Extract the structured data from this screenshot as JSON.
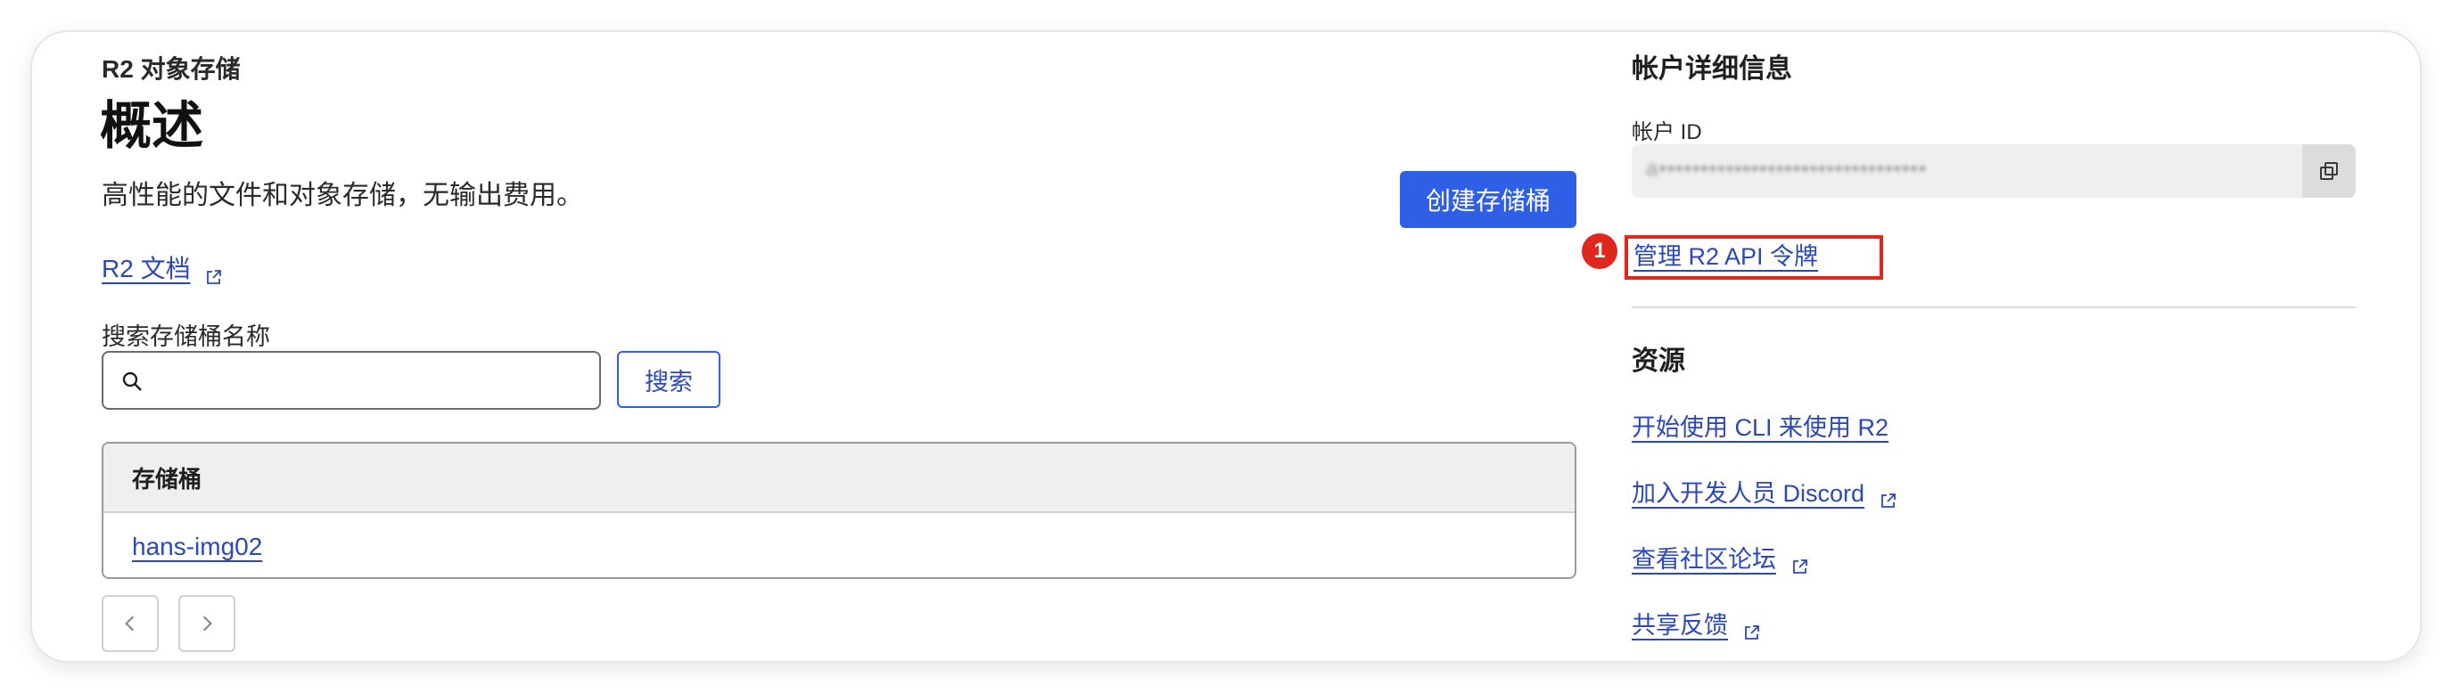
{
  "left": {
    "breadcrumb": "R2 对象存储",
    "title": "概述",
    "description": "高性能的文件和对象存储，无输出费用。",
    "create_button": "创建存储桶",
    "docs_link": "R2 文档",
    "search_label": "搜索存储桶名称",
    "search_placeholder": "",
    "search_button": "搜索",
    "table": {
      "header": "存储桶",
      "rows": [
        {
          "name": "hans-img02"
        }
      ]
    }
  },
  "right": {
    "account_heading": "帐户详细信息",
    "account_id_label": "帐户 ID",
    "account_id_value": "a••••••••••••••••••••••••••••••••",
    "manage_token_link": "管理 R2 API 令牌",
    "annotation_number": "1",
    "resources_heading": "资源",
    "resources": [
      {
        "label": "开始使用 CLI 来使用 R2",
        "external": false
      },
      {
        "label": "加入开发人员 Discord",
        "external": true
      },
      {
        "label": "查看社区论坛",
        "external": true
      },
      {
        "label": "共享反馈",
        "external": true
      }
    ]
  },
  "colors": {
    "primary_button": "#2f5fe6",
    "link": "#2b48b8",
    "annotation_red": "#e0271e"
  },
  "icons": [
    "search-icon",
    "external-link-icon",
    "copy-icon",
    "chevron-left-icon",
    "chevron-right-icon"
  ]
}
